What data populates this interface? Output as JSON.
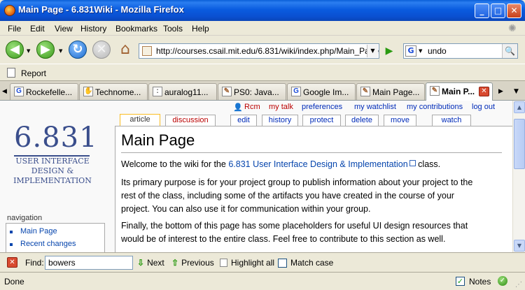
{
  "window": {
    "title": "Main Page - 6.831Wiki - Mozilla Firefox",
    "minimize": "_",
    "maximize": "□",
    "close": "✕"
  },
  "menu": [
    "File",
    "Edit",
    "View",
    "History",
    "Bookmarks",
    "Tools",
    "Help"
  ],
  "nav": {
    "url": "http://courses.csail.mit.edu/6.831/wiki/index.php/Main_Page",
    "search_value": "undo",
    "search_engine_icon": "google-icon"
  },
  "bookmarks": [
    {
      "label": "Report"
    }
  ],
  "tabs": [
    {
      "label": "Rockefelle...",
      "icon": "G"
    },
    {
      "label": "Technome...",
      "icon": "✋"
    },
    {
      "label": "auralog11...",
      "icon": ":"
    },
    {
      "label": "PS0: Java...",
      "icon": "✎"
    },
    {
      "label": "Google Im...",
      "icon": "G"
    },
    {
      "label": "Main Page...",
      "icon": "✎"
    },
    {
      "label": "Main P...",
      "icon": "✎",
      "active": true
    }
  ],
  "wiki": {
    "logo_number": "6.831",
    "logo_subtitle": "USER INTERFACE DESIGN & IMPLEMENTATION",
    "navigation_heading": "navigation",
    "nav_links": [
      "Main Page",
      "Recent changes"
    ],
    "personal_links": [
      "Rcm",
      "my talk",
      "preferences",
      "my watchlist",
      "my contributions",
      "log out"
    ],
    "content_tabs": [
      "article",
      "discussion",
      "edit",
      "history",
      "protect",
      "delete",
      "move",
      "watch"
    ],
    "page_title": "Main Page",
    "para1_prefix": "Welcome to the wiki for the ",
    "para1_link": "6.831 User Interface Design & Implementation",
    "para1_suffix": " class.",
    "para2_line1": "Its primary purpose is for your project group to publish information about your project to the",
    "para2_line2": "rest of the class, including some of the artifacts you have created in the course of your",
    "para2_line3": "project. You can also use it for communication within your group.",
    "para3_line1": "Finally, the bottom of this page has some placeholders for useful UI design resources that",
    "para3_line2": "would be of interest to the entire class. Feel free to contribute to this section as well."
  },
  "findbar": {
    "label": "Find:",
    "value": "bowers",
    "next": "Next",
    "previous": "Previous",
    "highlight": "Highlight all",
    "match_case": "Match case"
  },
  "status": {
    "text": "Done",
    "notes_label": "Notes"
  }
}
